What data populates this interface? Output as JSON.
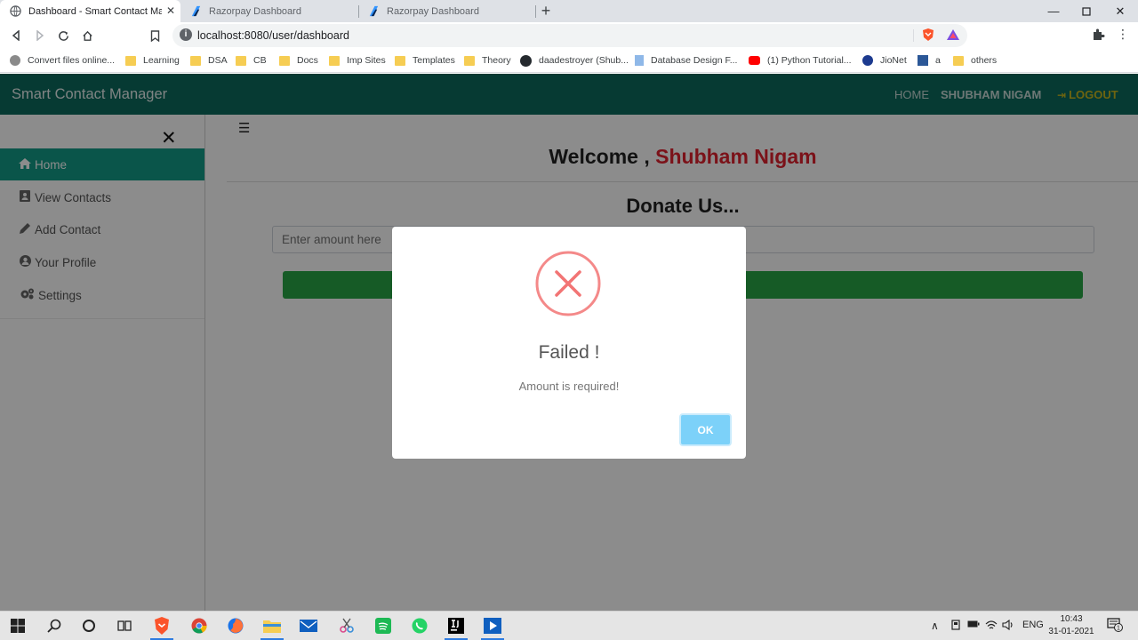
{
  "browser": {
    "tabs": [
      {
        "title": "Dashboard - Smart Contact Mana",
        "icon": "globe-icon",
        "active": true
      },
      {
        "title": "Razorpay Dashboard",
        "icon": "razorpay-icon",
        "active": false
      },
      {
        "title": "Razorpay Dashboard",
        "icon": "razorpay-icon",
        "active": false
      }
    ],
    "new_tab": "+",
    "url": "localhost:8080/user/dashboard",
    "bookmarks": [
      {
        "label": "Convert files online...",
        "icon": "convert-icon"
      },
      {
        "label": "Learning",
        "icon": "folder-icon"
      },
      {
        "label": "DSA",
        "icon": "folder-icon"
      },
      {
        "label": "CB",
        "icon": "folder-icon"
      },
      {
        "label": "Docs",
        "icon": "folder-icon"
      },
      {
        "label": "Imp Sites",
        "icon": "folder-icon"
      },
      {
        "label": "Templates",
        "icon": "folder-icon"
      },
      {
        "label": "Theory",
        "icon": "folder-icon"
      },
      {
        "label": "daadestroyer (Shub...",
        "icon": "github-icon"
      },
      {
        "label": "Database Design F...",
        "icon": "page-icon"
      },
      {
        "label": "(1) Python Tutorial...",
        "icon": "youtube-icon"
      },
      {
        "label": "JioNet",
        "icon": "jio-icon"
      },
      {
        "label": "a",
        "icon": "word-icon"
      },
      {
        "label": "others",
        "icon": "folder-icon"
      }
    ]
  },
  "app": {
    "brand": "Smart Contact Manager",
    "nav": {
      "home": "HOME",
      "user": "SHUBHAM NIGAM",
      "logout": "LOGOUT"
    },
    "sidebar": {
      "close": "✕",
      "items": [
        {
          "label": "Home",
          "icon": "home-icon",
          "active": true
        },
        {
          "label": "View Contacts",
          "icon": "address-book-icon",
          "active": false
        },
        {
          "label": "Add Contact",
          "icon": "pencil-icon",
          "active": false
        },
        {
          "label": "Your Profile",
          "icon": "user-circle-icon",
          "active": false
        },
        {
          "label": "Settings",
          "icon": "gears-icon",
          "active": false
        }
      ]
    },
    "main": {
      "welcome_prefix": "Welcome ,",
      "welcome_name": "Shubham Nigam",
      "donate_title": "Donate Us...",
      "amount_placeholder": "Enter amount here"
    },
    "modal": {
      "title": "Failed !",
      "message": "Amount is required!",
      "ok": "OK"
    }
  },
  "taskbar": {
    "language": "ENG",
    "time": "10:43",
    "date": "31-01-2021",
    "notifications": "1"
  },
  "colors": {
    "navbar": "#0b6b5e",
    "sidebar_active": "#139b87",
    "username": "#e0212e",
    "donate_button": "#28a745",
    "error": "#f27474",
    "ok_button": "#7cd1f9"
  }
}
